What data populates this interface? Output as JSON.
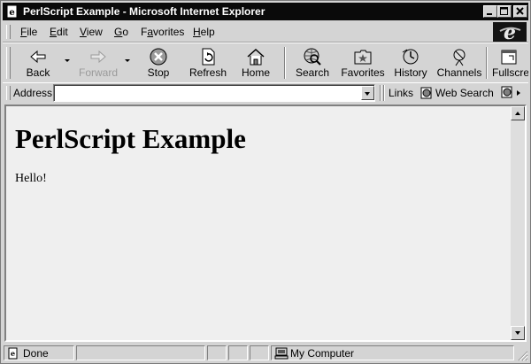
{
  "window": {
    "title": "PerlScript Example - Microsoft Internet Explorer"
  },
  "menu": [
    "File",
    "Edit",
    "View",
    "Go",
    "Favorites",
    "Help"
  ],
  "menu_underline": [
    "F",
    "E",
    "V",
    "G",
    "a",
    "H"
  ],
  "toolbar": {
    "back": "Back",
    "forward": "Forward",
    "stop": "Stop",
    "refresh": "Refresh",
    "home": "Home",
    "search": "Search",
    "favorites": "Favorites",
    "history": "History",
    "channels": "Channels",
    "fullscreen": "Fullscre"
  },
  "address": {
    "label": "Address",
    "value": ""
  },
  "links": {
    "label": "Links",
    "web_search": "Web Search"
  },
  "page": {
    "heading": "PerlScript Example",
    "text": "Hello!"
  },
  "status": {
    "text": "Done",
    "zone": "My Computer"
  }
}
